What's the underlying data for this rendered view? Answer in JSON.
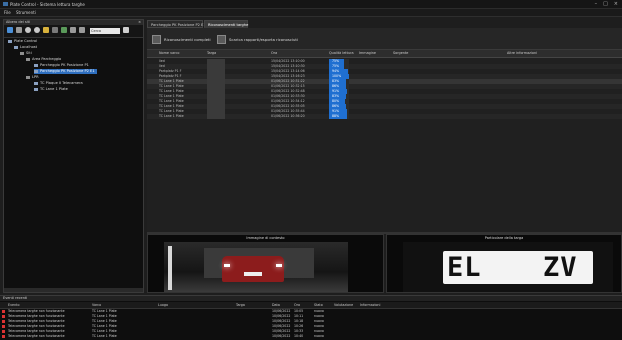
{
  "window": {
    "title": "Plate Control - Sistema lettura targhe",
    "controls": [
      "–",
      "□",
      "×"
    ]
  },
  "menu": [
    "File",
    "Strumenti"
  ],
  "tree_panel": {
    "title": "Albero dei siti",
    "close": "×",
    "search_value": "Cerca",
    "nodes": [
      {
        "label": "Plate Control",
        "level": 0,
        "selected": false
      },
      {
        "label": "Localhost",
        "level": 1,
        "selected": false
      },
      {
        "label": "Siti",
        "level": 2,
        "selected": false
      },
      {
        "label": "Area Parcheggio",
        "level": 3,
        "selected": false
      },
      {
        "label": "Parcheggio PK Posizione P1",
        "level": 4,
        "selected": false
      },
      {
        "label": "Parcheggio PK Posizione P2 E1",
        "level": 4,
        "selected": true
      },
      {
        "label": "LPR",
        "level": 3,
        "selected": false
      },
      {
        "label": "TC Plaque II Telecamera",
        "level": 4,
        "selected": false
      },
      {
        "label": "TC Lane 1 Plate",
        "level": 4,
        "selected": false
      }
    ]
  },
  "tabs": [
    {
      "label": "Parcheggio PK Posizione P2 E1",
      "active": false
    },
    {
      "label": "Riconoscimenti targhe",
      "active": true
    }
  ],
  "toolbar": {
    "button1": "Riconoscimenti completi",
    "button2": "Scarica rapporti/esporta riconosciuti"
  },
  "grid": {
    "columns": [
      "Nome varco",
      "Targa",
      "Ora",
      "Qualità lettura",
      "Immagine",
      "Sorgente",
      "Altre informazioni"
    ],
    "rows": [
      {
        "name": "lied",
        "plate": "",
        "time": "15/04/2022 13:10:00",
        "quality": 75,
        "quality_label": "75%"
      },
      {
        "name": "lied",
        "plate": "",
        "time": "15/04/2022 13:10:30",
        "quality": 75,
        "quality_label": "75%"
      },
      {
        "name": "Parkplatz P1 F",
        "plate": "",
        "time": "15/04/2022 13:14:06",
        "quality": 94,
        "quality_label": "94%"
      },
      {
        "name": "Parkplatz P1 F",
        "plate": "",
        "time": "15/04/2022 13:16:23",
        "quality": 100,
        "quality_label": "100%"
      },
      {
        "name": "TC Lane 1 Plate",
        "plate": "",
        "time": "01/06/2022 10:31:22",
        "quality": 83,
        "quality_label": "83%"
      },
      {
        "name": "TC Lane 1 Plate",
        "plate": "",
        "time": "01/06/2022 10:32:15",
        "quality": 86,
        "quality_label": "86%"
      },
      {
        "name": "TC Lane 1 Plate",
        "plate": "",
        "time": "01/06/2022 10:32:48",
        "quality": 91,
        "quality_label": "91%"
      },
      {
        "name": "TC Lane 1 Plate",
        "plate": "",
        "time": "01/06/2022 10:33:30",
        "quality": 83,
        "quality_label": "83%"
      },
      {
        "name": "TC Lane 1 Plate",
        "plate": "",
        "time": "01/06/2022 10:34:12",
        "quality": 80,
        "quality_label": "80%"
      },
      {
        "name": "TC Lane 1 Plate",
        "plate": "",
        "time": "01/06/2022 10:35:05",
        "quality": 86,
        "quality_label": "86%"
      },
      {
        "name": "TC Lane 1 Plate",
        "plate": "",
        "time": "01/06/2022 10:35:44",
        "quality": 91,
        "quality_label": "91%"
      },
      {
        "name": "TC Lane 1 Plate",
        "plate": "",
        "time": "01/06/2022 10:36:20",
        "quality": 88,
        "quality_label": "88%"
      }
    ]
  },
  "images": {
    "scene_title": "Immagine di contesto",
    "plate_title": "Particolare della targa",
    "plate_left": "EL",
    "plate_right": "ZV"
  },
  "events": {
    "title": "Eventi recenti",
    "columns": [
      "Evento",
      "Varco",
      "Luogo",
      "Targa",
      "Data",
      "Ora",
      "Stato",
      "Valutazione",
      "Informazioni"
    ],
    "rows": [
      {
        "event": "Telecamera targhe non funzionante",
        "gate": "TC Lane 1 Plate",
        "date": "10/06/2022",
        "time": "10:05",
        "state": "nuovo"
      },
      {
        "event": "Telecamera targhe non funzionante",
        "gate": "TC Lane 1 Plate",
        "date": "10/06/2022",
        "time": "10:11",
        "state": "nuovo"
      },
      {
        "event": "Telecamera targhe non funzionante",
        "gate": "TC Lane 1 Plate",
        "date": "10/06/2022",
        "time": "10:18",
        "state": "nuovo"
      },
      {
        "event": "Telecamera targhe non funzionante",
        "gate": "TC Lane 1 Plate",
        "date": "10/06/2022",
        "time": "10:26",
        "state": "nuovo"
      },
      {
        "event": "Telecamera targhe non funzionante",
        "gate": "TC Lane 1 Plate",
        "date": "10/06/2022",
        "time": "10:33",
        "state": "nuovo"
      },
      {
        "event": "Telecamera targhe non funzionante",
        "gate": "TC Lane 1 Plate",
        "date": "10/06/2022",
        "time": "10:40",
        "state": "nuovo"
      }
    ]
  },
  "colors": {
    "accent": "#1f6fd1",
    "selection": "#2f6fbf",
    "alert": "#dd3333",
    "background": "#1e1e1e"
  }
}
